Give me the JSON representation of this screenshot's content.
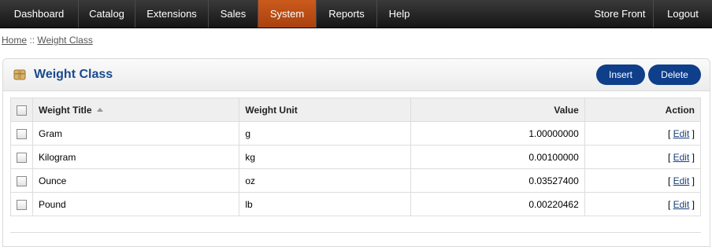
{
  "menu": {
    "items": [
      "Dashboard",
      "Catalog",
      "Extensions",
      "Sales",
      "System",
      "Reports",
      "Help"
    ],
    "active": "System",
    "right": [
      "Store Front",
      "Logout"
    ],
    "accent": "#c4551a"
  },
  "breadcrumb": {
    "home": "Home",
    "separator": "::",
    "current": "Weight Class"
  },
  "heading": {
    "title": "Weight Class",
    "icon": "box-icon",
    "insert_label": "Insert",
    "delete_label": "Delete",
    "button_color": "#0f3f8a"
  },
  "table": {
    "columns": [
      "Weight Title",
      "Weight Unit",
      "Value",
      "Action"
    ],
    "rows": [
      {
        "title": "Gram",
        "unit": "g",
        "value": "1.00000000",
        "action_open": "[",
        "action": "Edit",
        "action_close": "]"
      },
      {
        "title": "Kilogram",
        "unit": "kg",
        "value": "0.00100000",
        "action_open": "[",
        "action": "Edit",
        "action_close": "]"
      },
      {
        "title": "Ounce",
        "unit": "oz",
        "value": "0.03527400",
        "action_open": "[",
        "action": "Edit",
        "action_close": "]"
      },
      {
        "title": "Pound",
        "unit": "lb",
        "value": "0.00220462",
        "action_open": "[",
        "action": "Edit",
        "action_close": "]"
      }
    ]
  }
}
